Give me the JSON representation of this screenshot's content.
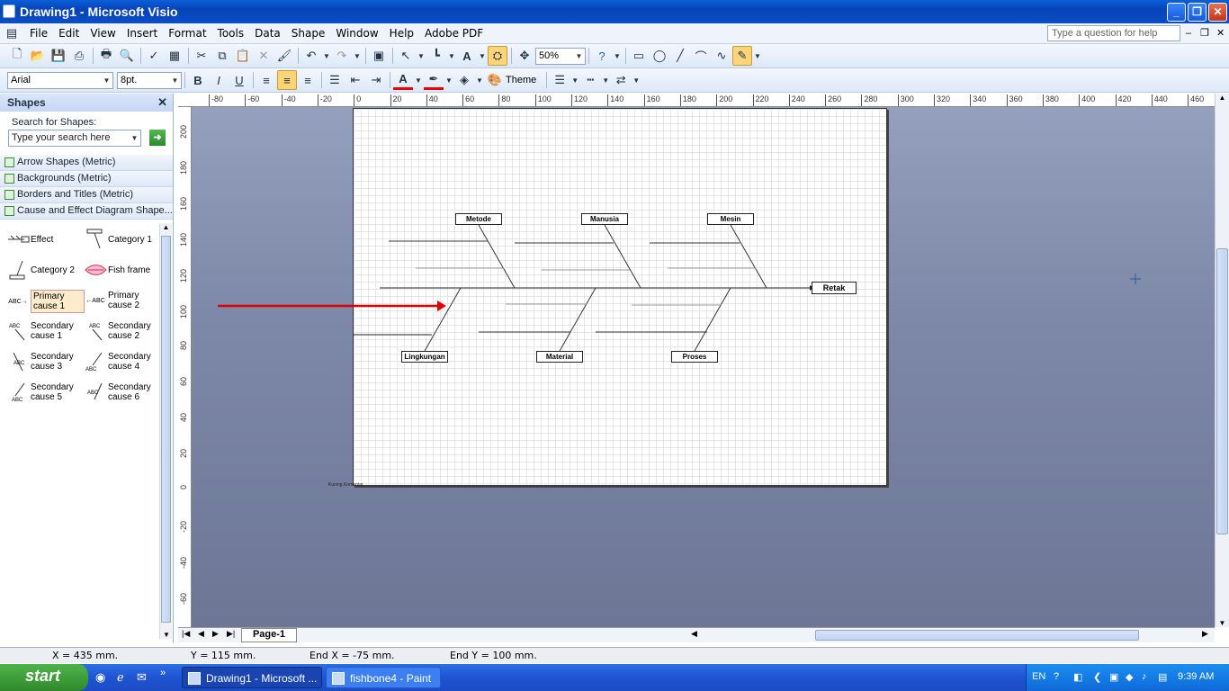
{
  "window": {
    "title": "Drawing1 - Microsoft Visio",
    "min": "_",
    "max": "❐",
    "close": "✕"
  },
  "menu": [
    "File",
    "Edit",
    "View",
    "Insert",
    "Format",
    "Tools",
    "Data",
    "Shape",
    "Window",
    "Help",
    "Adobe PDF"
  ],
  "help_placeholder": "Type a question for help",
  "toolbar": {
    "zoom": "50%",
    "font": "Arial",
    "size": "8pt.",
    "theme": "Theme"
  },
  "shapes_panel": {
    "title": "Shapes",
    "search_label": "Search for Shapes:",
    "search_placeholder": "Type your search here",
    "stencils": [
      "Arrow Shapes (Metric)",
      "Backgrounds (Metric)",
      "Borders and Titles (Metric)",
      "Cause and Effect Diagram Shape..."
    ],
    "masters": [
      {
        "label": "Effect",
        "icon": "effect-icon"
      },
      {
        "label": "Category 1",
        "icon": "category-1-icon"
      },
      {
        "label": "Category 2",
        "icon": "category-2-icon"
      },
      {
        "label": "Fish frame",
        "icon": "fish-frame-icon"
      },
      {
        "label": "Primary cause 1",
        "icon": "primary-cause-1-icon"
      },
      {
        "label": "Primary cause 2",
        "icon": "primary-cause-2-icon"
      },
      {
        "label": "Secondary cause 1",
        "icon": "secondary-cause-1-icon"
      },
      {
        "label": "Secondary cause 2",
        "icon": "secondary-cause-2-icon"
      },
      {
        "label": "Secondary cause 3",
        "icon": "secondary-cause-3-icon"
      },
      {
        "label": "Secondary cause 4",
        "icon": "secondary-cause-4-icon"
      },
      {
        "label": "Secondary cause 5",
        "icon": "secondary-cause-5-icon"
      },
      {
        "label": "Secondary cause 6",
        "icon": "secondary-cause-6-icon"
      }
    ]
  },
  "ruler_top": [
    "-80",
    "-60",
    "-40",
    "-20",
    "0",
    "20",
    "40",
    "60",
    "80",
    "100",
    "120",
    "140",
    "160",
    "180",
    "200",
    "220",
    "240",
    "260",
    "280",
    "300",
    "320",
    "340",
    "360",
    "380",
    "400",
    "420",
    "440",
    "460"
  ],
  "ruler_left": [
    "200",
    "180",
    "160",
    "140",
    "120",
    "100",
    "80",
    "60",
    "40",
    "20",
    "0",
    "-20",
    "-40",
    "-60"
  ],
  "diagram": {
    "effect": "Retak",
    "top_categories": [
      "Metode",
      "Manusia",
      "Mesin"
    ],
    "bottom_categories": [
      "Lingkungan",
      "Material",
      "Proses"
    ],
    "small_text": "Kuning Komentar"
  },
  "pagetab": "Page-1",
  "status": {
    "x": "X = 435 mm.",
    "y": "Y = 115 mm.",
    "endx": "End X = -75 mm.",
    "endy": "End Y = 100 mm."
  },
  "taskbar": {
    "start": "start",
    "tasks": [
      "Drawing1 - Microsoft ...",
      "fishbone4 - Paint"
    ],
    "lang": "EN",
    "time": "9:39 AM"
  },
  "colors": {
    "accent_arrow": "#e00000",
    "titlebar": "#0a54d0"
  }
}
